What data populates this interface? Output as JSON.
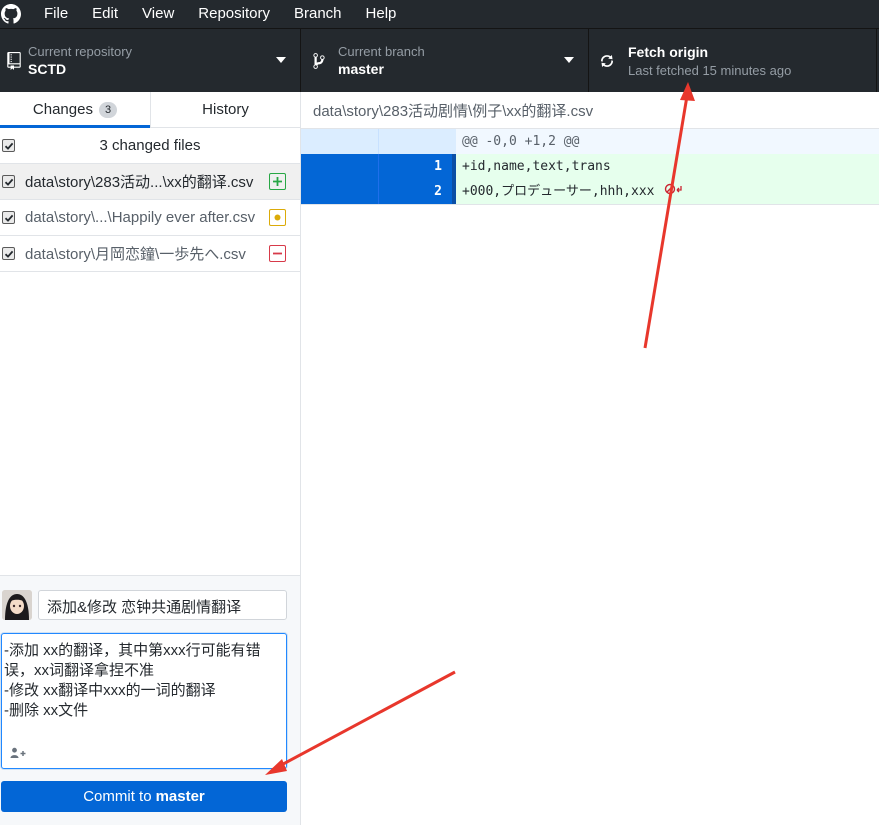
{
  "menu": {
    "items": [
      "File",
      "Edit",
      "View",
      "Repository",
      "Branch",
      "Help"
    ]
  },
  "toolbar": {
    "repository": {
      "label": "Current repository",
      "value": "SCTD"
    },
    "branch": {
      "label": "Current branch",
      "value": "master"
    },
    "fetch": {
      "label": "Fetch origin",
      "value": "Last fetched 15 minutes ago"
    }
  },
  "sidebar": {
    "tabs": {
      "changes": "Changes",
      "changes_count": "3",
      "history": "History"
    },
    "changed_files_label": "3 changed files",
    "files": [
      {
        "path": "data\\story\\283活动...\\xx的翻译.csv",
        "status": "added"
      },
      {
        "path": "data\\story\\...\\Happily ever after.csv",
        "status": "modified"
      },
      {
        "path": "data\\story\\月岡恋鐘\\一歩先へ.csv",
        "status": "deleted"
      }
    ]
  },
  "commit": {
    "summary": "添加&修改 恋钟共通剧情翻译",
    "description_lines": [
      "-添加 xx的翻译，其中第xxx行可能有错",
      "误，xx词翻译拿捏不准",
      "-修改 xx翻译中xxx的一词的翻译",
      "-删除 xx文件"
    ],
    "button_prefix": "Commit to",
    "button_branch": "master"
  },
  "diff": {
    "file_path": "data\\story\\283活动剧情\\例子\\xx的翻译.csv",
    "hunk_header": "@@ -0,0 +1,2 @@",
    "lines": [
      {
        "number": "1",
        "text": "+id,name,text,trans"
      },
      {
        "number": "2",
        "text": "+000,プロデューサー,hhh,xxx"
      }
    ]
  },
  "colors": {
    "chrome": "#24292e",
    "accent": "#0366d6",
    "added": "#28a745",
    "modified": "#dbab09",
    "deleted": "#d73a49",
    "annotation_arrow": "#e8372c"
  }
}
